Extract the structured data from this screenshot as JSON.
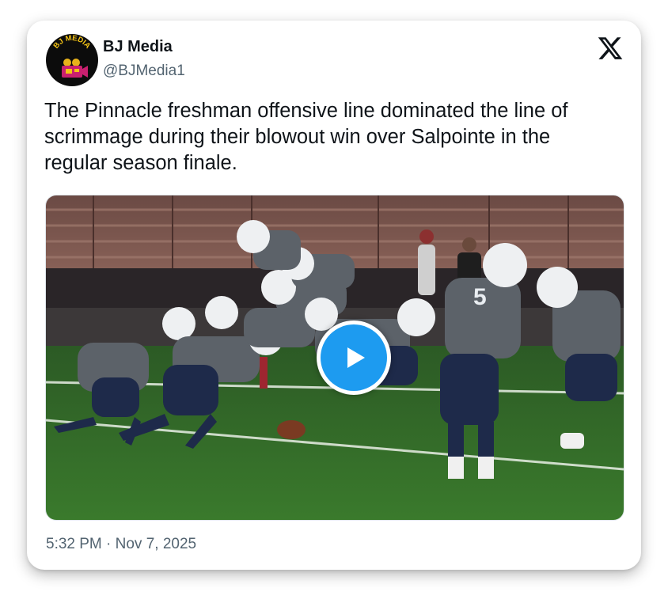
{
  "author": {
    "display_name": "BJ Media",
    "handle": "@BJMedia1",
    "avatar_text": "BJ MEDIA",
    "avatar_icon": "camera-icon"
  },
  "platform_icon": "x-logo-icon",
  "tweet": {
    "text": "The Pinnacle freshman offensive line dominated the line of scrimmage during their blowout win over Salpointe in the regular season finale.",
    "timestamp": "5:32 PM · Nov 7, 2025"
  },
  "media": {
    "type": "video",
    "play_icon": "play-icon",
    "jersey_number": "5",
    "accent_color": "#1d9bf0"
  },
  "colors": {
    "text_primary": "#0f1419",
    "text_secondary": "#536471",
    "play_button": "#1d9bf0"
  }
}
